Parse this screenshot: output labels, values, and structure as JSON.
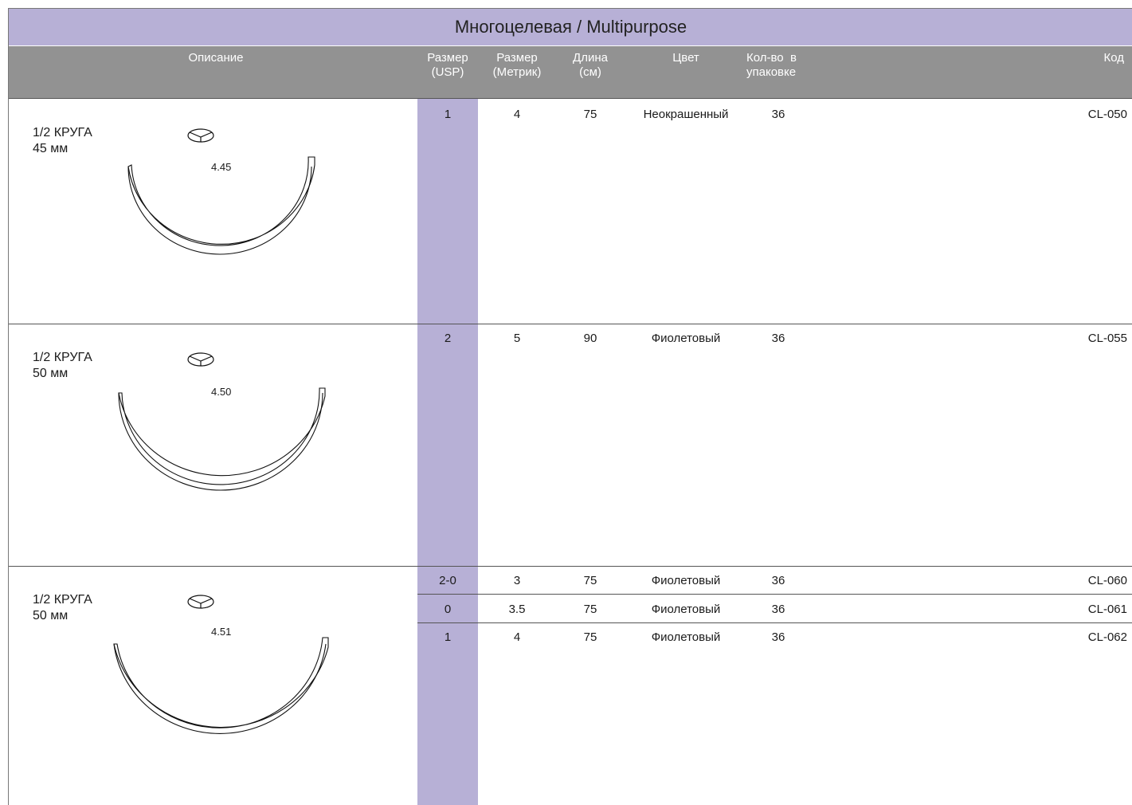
{
  "title": "Многоцелевая / Multipurpose",
  "header": {
    "description": "Описание",
    "size_usp": [
      "Размер",
      "(USP)"
    ],
    "size_metric": [
      "Размер",
      "(Метрик)"
    ],
    "length": [
      "Длина",
      "(см)"
    ],
    "color": "Цвет",
    "pack_qty": [
      "Кол-во  в",
      "упаковке"
    ],
    "code": "Код"
  },
  "sections": [
    {
      "desc_line1": "1/2 КРУГА",
      "desc_line2": "45 мм",
      "needle_code": "4.45",
      "rows": [
        {
          "usp": "1",
          "metric": "4",
          "length": "75",
          "color": "Неокрашенный",
          "qty": "36",
          "code": "CL-050"
        }
      ]
    },
    {
      "desc_line1": "1/2 КРУГА",
      "desc_line2": "50 мм",
      "needle_code": "4.50",
      "rows": [
        {
          "usp": "2",
          "metric": "5",
          "length": "90",
          "color": "Фиолетовый",
          "qty": "36",
          "code": "CL-055"
        }
      ]
    },
    {
      "desc_line1": "1/2 КРУГА",
      "desc_line2": "50 мм",
      "needle_code": "4.51",
      "rows": [
        {
          "usp": "2-0",
          "metric": "3",
          "length": "75",
          "color": "Фиолетовый",
          "qty": "36",
          "code": "CL-060"
        },
        {
          "usp": "0",
          "metric": "3.5",
          "length": "75",
          "color": "Фиолетовый",
          "qty": "36",
          "code": "CL-061"
        },
        {
          "usp": "1",
          "metric": "4",
          "length": "75",
          "color": "Фиолетовый",
          "qty": "36",
          "code": "CL-062"
        }
      ]
    }
  ],
  "colors": {
    "accent": "#b7b0d6",
    "header_gray": "#929292"
  },
  "icons": {
    "needle_cross_section": "triangle-cross-section-icon",
    "needle_shape": "half-circle-needle-icon"
  }
}
